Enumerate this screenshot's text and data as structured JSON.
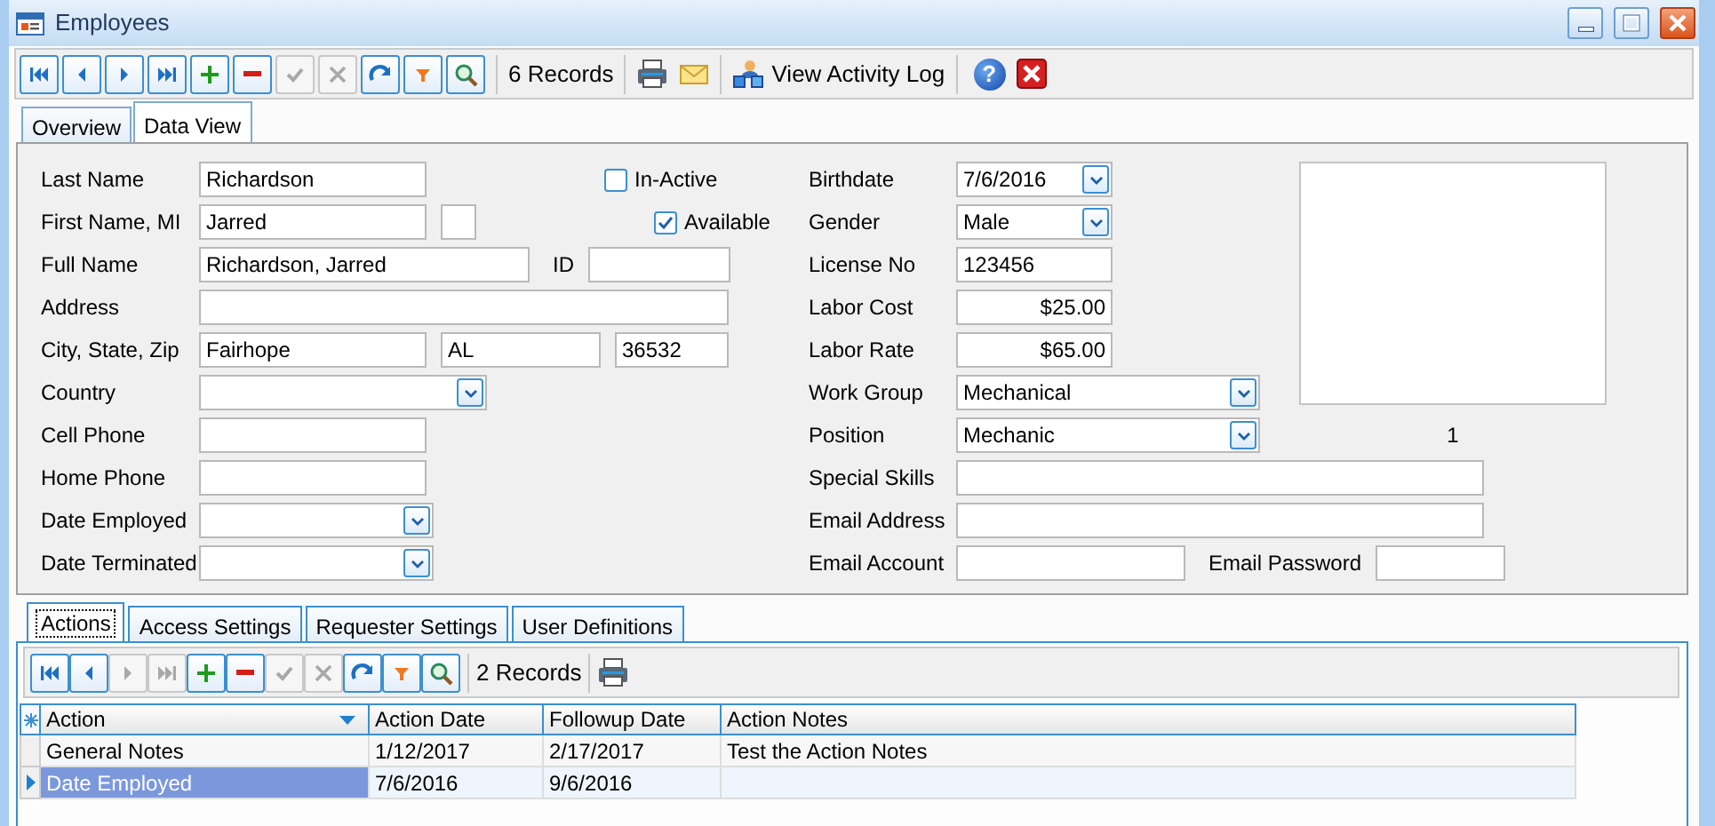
{
  "window": {
    "title": "Employees"
  },
  "toolbar": {
    "buttons": [
      {
        "kind": "first",
        "disabled": false
      },
      {
        "kind": "prev",
        "disabled": false
      },
      {
        "kind": "next",
        "disabled": false
      },
      {
        "kind": "last",
        "disabled": false
      },
      {
        "kind": "add",
        "disabled": false
      },
      {
        "kind": "delete",
        "disabled": false
      },
      {
        "kind": "save",
        "disabled": true
      },
      {
        "kind": "cancel",
        "disabled": true
      },
      {
        "kind": "refresh",
        "disabled": false
      },
      {
        "kind": "filter",
        "disabled": false
      },
      {
        "kind": "search",
        "disabled": false
      }
    ],
    "record_count": "6 Records",
    "activity_log": "View Activity Log",
    "help": "?"
  },
  "tabs": [
    {
      "label": "Overview",
      "selected": false
    },
    {
      "label": "Data View",
      "selected": true
    }
  ],
  "left_rows": [
    {
      "label": "Last Name",
      "controls": [
        {
          "kind": "text",
          "value": "Richardson"
        },
        {
          "kind": "checkbox",
          "label": "In-Active",
          "checked": false
        }
      ]
    },
    {
      "label": "First Name, MI",
      "controls": [
        {
          "kind": "text",
          "value": "Jarred"
        },
        {
          "kind": "text"
        },
        {
          "kind": "checkbox",
          "label": "Available",
          "checked": true
        }
      ]
    },
    {
      "label": "Full Name",
      "controls": [
        {
          "kind": "text",
          "value": "Richardson, Jarred"
        },
        {
          "kind": "label",
          "label": "ID"
        },
        {
          "kind": "text"
        }
      ]
    },
    {
      "label": "Address",
      "controls": [
        {
          "kind": "text"
        }
      ]
    },
    {
      "label": "City, State, Zip",
      "controls": [
        {
          "kind": "text",
          "value": "Fairhope"
        },
        {
          "kind": "text",
          "value": "AL"
        },
        {
          "kind": "text",
          "value": "36532"
        }
      ]
    },
    {
      "label": "Country",
      "controls": [
        {
          "kind": "combo"
        }
      ]
    },
    {
      "label": "Cell Phone",
      "controls": [
        {
          "kind": "text"
        }
      ]
    },
    {
      "label": "Home Phone",
      "controls": [
        {
          "kind": "text"
        }
      ]
    },
    {
      "label": "Date Employed",
      "controls": [
        {
          "kind": "combo"
        }
      ]
    },
    {
      "label": "Date Terminated",
      "controls": [
        {
          "kind": "combo"
        }
      ]
    }
  ],
  "right_rows": [
    {
      "label": "Birthdate",
      "controls": [
        {
          "kind": "combo",
          "value": "7/6/2016"
        }
      ]
    },
    {
      "label": "Gender",
      "controls": [
        {
          "kind": "combo",
          "value": "Male"
        }
      ]
    },
    {
      "label": "License No",
      "controls": [
        {
          "kind": "text",
          "value": "123456"
        }
      ]
    },
    {
      "label": "Labor Cost",
      "controls": [
        {
          "kind": "amount",
          "value": "$25.00"
        }
      ]
    },
    {
      "label": "Labor Rate",
      "controls": [
        {
          "kind": "amount",
          "value": "$65.00"
        }
      ]
    },
    {
      "label": "Work Group",
      "controls": [
        {
          "kind": "combo",
          "value": "Mechanical"
        }
      ]
    },
    {
      "label": "Position",
      "controls": [
        {
          "kind": "combo",
          "value": "Mechanic"
        }
      ]
    },
    {
      "label": "Special Skills",
      "controls": [
        {
          "kind": "text"
        }
      ]
    },
    {
      "label": "Email Address",
      "controls": [
        {
          "kind": "text"
        }
      ]
    },
    {
      "label": "Email Account",
      "controls": [
        {
          "kind": "text"
        },
        {
          "kind": "label",
          "label": "Email Password"
        },
        {
          "kind": "text"
        }
      ]
    }
  ],
  "photo": {
    "caption": "1"
  },
  "sub_tabs": [
    {
      "label": "Actions",
      "selected": true
    },
    {
      "label": "Access Settings",
      "selected": false
    },
    {
      "label": "Requester Settings",
      "selected": false
    },
    {
      "label": "User Definitions",
      "selected": false
    }
  ],
  "sub_toolbar": {
    "buttons": [
      {
        "kind": "first",
        "disabled": false
      },
      {
        "kind": "prev",
        "disabled": false
      },
      {
        "kind": "next",
        "disabled": true
      },
      {
        "kind": "last",
        "disabled": true
      },
      {
        "kind": "add",
        "disabled": false
      },
      {
        "kind": "delete",
        "disabled": false
      },
      {
        "kind": "save",
        "disabled": true
      },
      {
        "kind": "cancel",
        "disabled": true
      },
      {
        "kind": "refresh",
        "disabled": false
      },
      {
        "kind": "filter",
        "disabled": false
      },
      {
        "kind": "search",
        "disabled": false
      }
    ],
    "record_count": "2 Records"
  },
  "table": {
    "columns": [
      {
        "label": "Action",
        "sorted": true
      },
      {
        "label": "Action Date",
        "sorted": false
      },
      {
        "label": "Followup Date",
        "sorted": false
      },
      {
        "label": "Action Notes",
        "sorted": false
      }
    ],
    "rows": [
      {
        "cells": [
          "General Notes",
          "1/12/2017",
          "2/17/2017",
          "Test the Action Notes"
        ],
        "selected": false
      },
      {
        "cells": [
          "Date Employed",
          "7/6/2016",
          "9/6/2016"
        ],
        "selected": true
      }
    ]
  }
}
